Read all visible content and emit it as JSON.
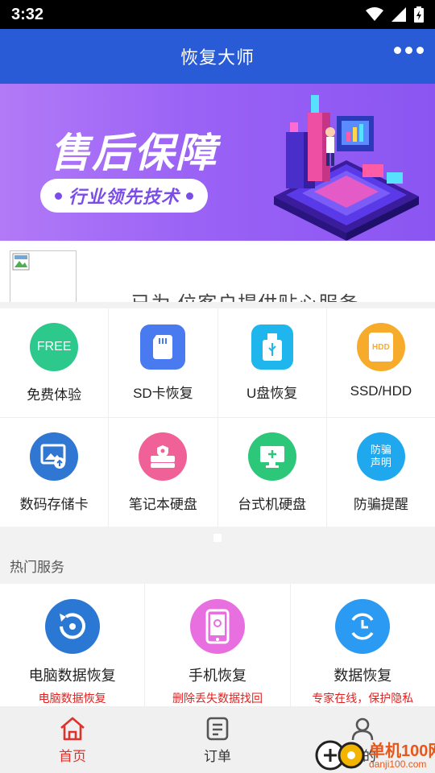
{
  "status_bar": {
    "time": "3:32"
  },
  "header": {
    "title": "恢复大师"
  },
  "banner": {
    "title": "售后保障",
    "pill_text": "行业领先技术"
  },
  "notice": {
    "text": "。 已为 位客户提供贴心服务"
  },
  "categories": [
    {
      "label": "免费体验",
      "icon": "free-icon",
      "icon_text": "FREE",
      "color": "#2dc88b"
    },
    {
      "label": "SD卡恢复",
      "icon": "sd-card-icon",
      "color": "#4a7af0"
    },
    {
      "label": "U盘恢复",
      "icon": "usb-drive-icon",
      "color": "#1fb6ee"
    },
    {
      "label": "SSD/HDD",
      "icon": "hdd-icon",
      "icon_text": "HDD",
      "color": "#f7ab2a"
    },
    {
      "label": "数码存储卡",
      "icon": "photo-upload-icon",
      "color": "#2f77d2"
    },
    {
      "label": "笔记本硬盘",
      "icon": "disk-shield-icon",
      "color": "#f06198"
    },
    {
      "label": "台式机硬盘",
      "icon": "monitor-icon",
      "color": "#2cc778"
    },
    {
      "label": "防骗提醒",
      "icon": "anti-fraud-icon",
      "icon_text_1": "防骗",
      "icon_text_2": "声明",
      "color": "#1fa8ee"
    }
  ],
  "section": {
    "hot_title": "热门服务"
  },
  "services": [
    {
      "name": "电脑数据恢复",
      "sub": "电脑数据恢复",
      "icon": "disk-restore-icon",
      "color": "#2a77d4"
    },
    {
      "name": "手机恢复",
      "sub": "删除丢失数据找回",
      "icon": "phone-icon",
      "color": "#e86fe0"
    },
    {
      "name": "数据恢复",
      "sub": "专家在线，保护隐私",
      "icon": "clock-refresh-icon",
      "color": "#2a9af2"
    }
  ],
  "tabs": [
    {
      "label": "首页",
      "icon": "home-icon",
      "active": true
    },
    {
      "label": "订单",
      "icon": "order-icon",
      "active": false
    },
    {
      "label": "我的",
      "icon": "user-icon",
      "active": false
    }
  ],
  "watermark": {
    "text": "单机100网",
    "url": "danji100.com"
  },
  "colors": {
    "header": "#2a5bd7",
    "active_tab": "#e0322c",
    "banner": "#9a62f5"
  }
}
